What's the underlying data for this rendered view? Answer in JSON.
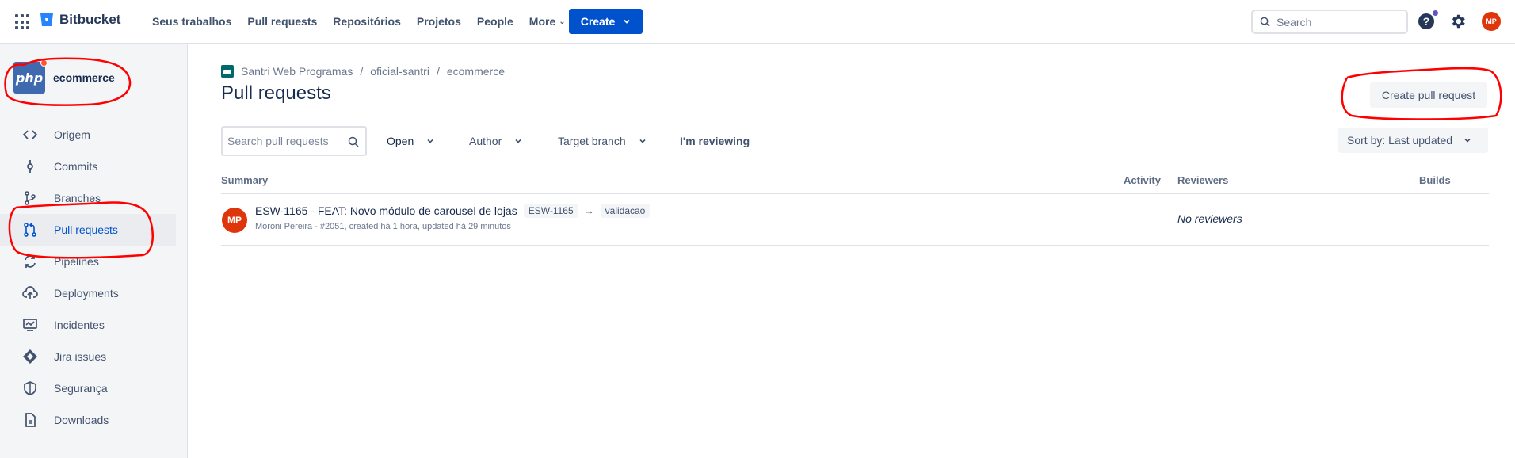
{
  "topnav": {
    "logo": "Bitbucket",
    "items": [
      {
        "label": "Seus trabalhos",
        "chevron": false
      },
      {
        "label": "Pull requests",
        "chevron": false
      },
      {
        "label": "Repositórios",
        "chevron": false
      },
      {
        "label": "Projetos",
        "chevron": false
      },
      {
        "label": "People",
        "chevron": false
      },
      {
        "label": "More",
        "chevron": true
      }
    ],
    "create_label": "Create",
    "search_placeholder": "Search",
    "user_initials": "MP"
  },
  "sidebar": {
    "repo_avatar_text": "php",
    "repo_name": "ecommerce",
    "items": [
      {
        "label": "Origem",
        "icon": "code-icon"
      },
      {
        "label": "Commits",
        "icon": "commit-icon"
      },
      {
        "label": "Branches",
        "icon": "branch-icon"
      },
      {
        "label": "Pull requests",
        "icon": "pull-request-icon",
        "active": true
      },
      {
        "label": "Pipelines",
        "icon": "pipelines-icon"
      },
      {
        "label": "Deployments",
        "icon": "cloud-upload-icon"
      },
      {
        "label": "Incidentes",
        "icon": "monitor-icon"
      },
      {
        "label": "Jira issues",
        "icon": "jira-icon"
      },
      {
        "label": "Segurança",
        "icon": "shield-icon"
      },
      {
        "label": "Downloads",
        "icon": "file-icon"
      }
    ]
  },
  "breadcrumb": {
    "workspace": "Santri Web Programas",
    "project": "oficial-santri",
    "repo": "ecommerce"
  },
  "page": {
    "title": "Pull requests",
    "create_pr_label": "Create pull request"
  },
  "filters": {
    "search_placeholder": "Search pull requests",
    "state": "Open",
    "author": "Author",
    "target_branch": "Target branch",
    "reviewing": "I'm reviewing",
    "sort": "Sort by: Last updated"
  },
  "table": {
    "headers": {
      "summary": "Summary",
      "activity": "Activity",
      "reviewers": "Reviewers",
      "builds": "Builds"
    },
    "rows": [
      {
        "avatar": "MP",
        "title": "ESW-1165 - FEAT: Novo módulo de carousel de lojas",
        "source_branch": "ESW-1165",
        "target_branch": "validacao",
        "meta": "Moroni Pereira - #2051, created há 1 hora, updated há 29 minutos",
        "reviewers": "No reviewers"
      }
    ]
  },
  "colors": {
    "primary": "#0052cc",
    "avatar": "#de350b",
    "annotation": "#ff0000"
  }
}
